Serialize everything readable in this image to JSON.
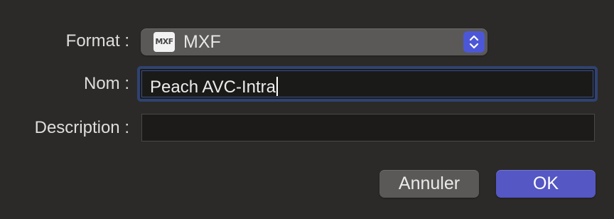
{
  "form": {
    "format_label": "Format :",
    "name_label": "Nom :",
    "description_label": "Description :"
  },
  "format_popup": {
    "icon": "mxf-file-icon",
    "icon_text": "MXF",
    "selected_value": "MXF",
    "arrows_icon": "up-down-chevrons-icon"
  },
  "name_field": {
    "value": "Peach AVC-Intra",
    "focused": true
  },
  "description_field": {
    "value": ""
  },
  "buttons": {
    "cancel_label": "Annuler",
    "ok_label": "OK"
  },
  "colors": {
    "accent": "#5557c4",
    "popup_arrows": "#4c57d7",
    "focus_ring": "#2e4372"
  }
}
